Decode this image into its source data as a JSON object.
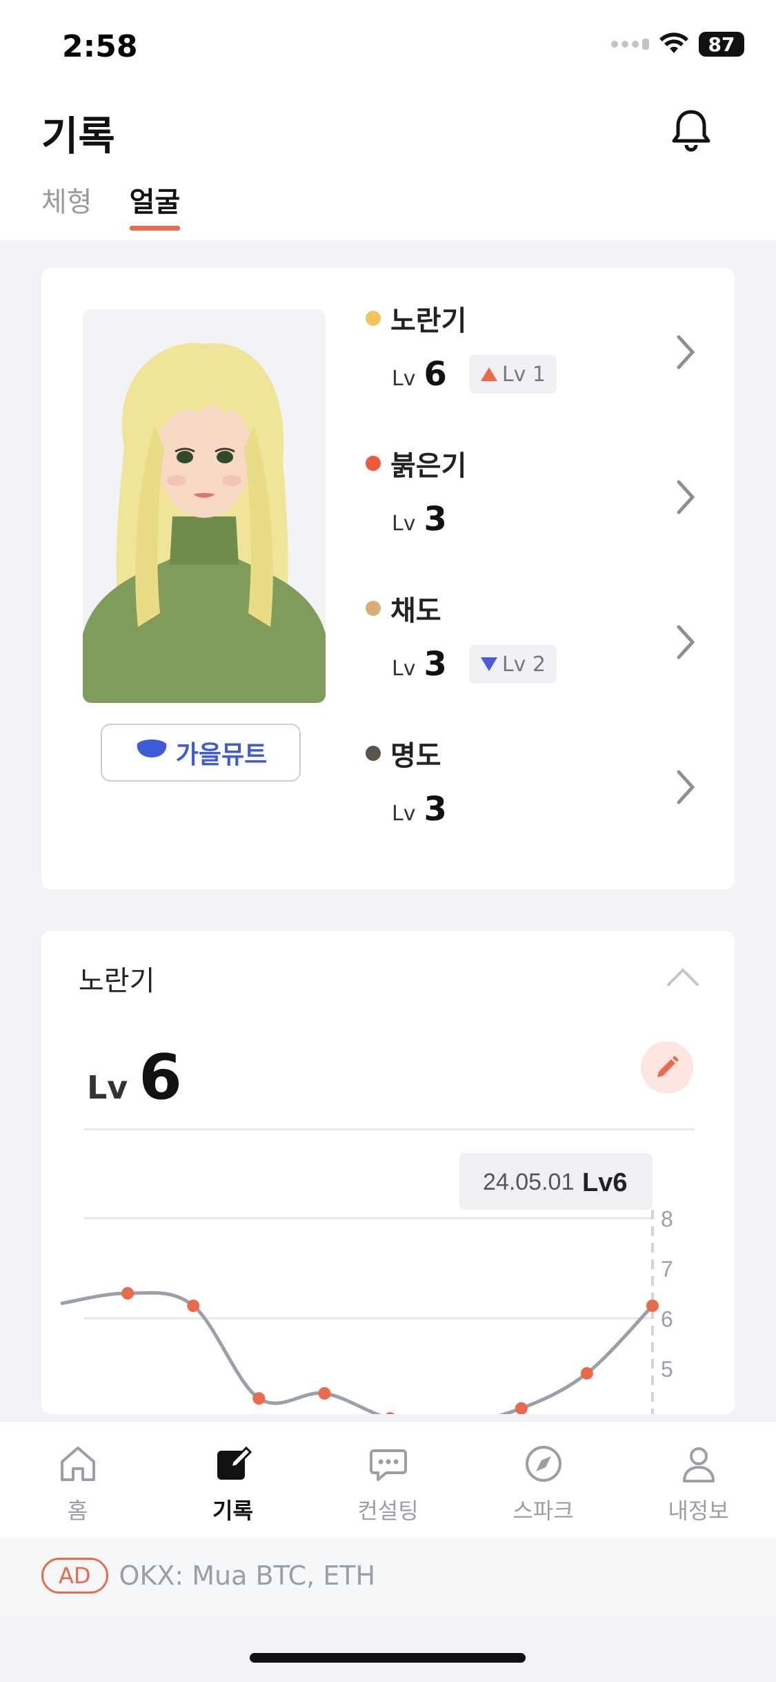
{
  "status": {
    "time": "2:58",
    "battery": "87"
  },
  "header": {
    "title": "기록",
    "tabs": [
      {
        "label": "체형"
      },
      {
        "label": "얼굴"
      }
    ]
  },
  "profile": {
    "season_label": "가을뮤트"
  },
  "metrics": [
    {
      "name": "노란기",
      "lv_prefix": "Lv",
      "level": "6",
      "color": "#f2c55c",
      "change": {
        "direction": "up",
        "text": "Lv 1",
        "color": "#ec6a4c"
      }
    },
    {
      "name": "붉은기",
      "lv_prefix": "Lv",
      "level": "3",
      "color": "#ec5a3c"
    },
    {
      "name": "채도",
      "lv_prefix": "Lv",
      "level": "3",
      "color": "#d7ae77",
      "change": {
        "direction": "down",
        "text": "Lv 2",
        "color": "#4a5be0"
      }
    },
    {
      "name": "명도",
      "lv_prefix": "Lv",
      "level": "3",
      "color": "#5d5449"
    }
  ],
  "detail": {
    "title": "노란기",
    "lv_prefix": "Lv",
    "level": "6",
    "tooltip": {
      "date": "24.05.01",
      "value": "Lv6"
    }
  },
  "chart_data": {
    "type": "line",
    "series": [
      {
        "values": [
          6.3,
          6.5,
          6.25,
          4.4,
          4.5,
          4.0,
          3.9,
          4.2,
          4.9,
          6.25
        ]
      }
    ],
    "y_ticks": [
      "8",
      "7",
      "6",
      "5"
    ],
    "ylim": [
      4.5,
      8.5
    ],
    "grid": true,
    "line_color": "#9aa0aa",
    "point_color": "#ec6a4c"
  },
  "nav": [
    {
      "label": "홈",
      "icon": "home-icon"
    },
    {
      "label": "기록",
      "icon": "edit-record-icon"
    },
    {
      "label": "컨설팅",
      "icon": "chat-icon"
    },
    {
      "label": "스파크",
      "icon": "compass-icon"
    },
    {
      "label": "내정보",
      "icon": "profile-icon"
    }
  ],
  "ad": {
    "tag": "AD",
    "text": "OKX: Mua BTC, ETH"
  }
}
